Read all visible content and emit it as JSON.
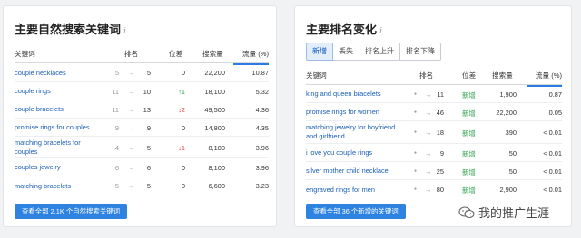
{
  "left_card": {
    "title": "主要自然搜索关键词",
    "info_glyph": "i",
    "headers": {
      "keyword": "关键词",
      "rank": "排名",
      "position": "位差",
      "volume": "搜索量",
      "traffic": "流量 (%)"
    },
    "rows": [
      {
        "keyword": "couple necklaces",
        "prev": "5",
        "arrow": "→",
        "rank": "5",
        "pos": "0",
        "dir": "none",
        "volume": "22,200",
        "traffic": "10.87"
      },
      {
        "keyword": "couple rings",
        "prev": "11",
        "arrow": "→",
        "rank": "10",
        "pos": "↑1",
        "dir": "up",
        "volume": "18,100",
        "traffic": "5.32"
      },
      {
        "keyword": "couple bracelets",
        "prev": "11",
        "arrow": "→",
        "rank": "13",
        "pos": "↓2",
        "dir": "down",
        "volume": "49,500",
        "traffic": "4.36"
      },
      {
        "keyword": "promise rings for couples",
        "prev": "9",
        "arrow": "→",
        "rank": "9",
        "pos": "0",
        "dir": "none",
        "volume": "14,800",
        "traffic": "4.35"
      },
      {
        "keyword": "matching bracelets for couples",
        "prev": "4",
        "arrow": "→",
        "rank": "5",
        "pos": "↓1",
        "dir": "down",
        "volume": "8,100",
        "traffic": "3.96"
      },
      {
        "keyword": "couples jewelry",
        "prev": "6",
        "arrow": "→",
        "rank": "6",
        "pos": "0",
        "dir": "none",
        "volume": "8,100",
        "traffic": "3.96"
      },
      {
        "keyword": "matching bracelets",
        "prev": "5",
        "arrow": "→",
        "rank": "5",
        "pos": "0",
        "dir": "none",
        "volume": "6,600",
        "traffic": "3.23"
      }
    ],
    "button": "查看全部 2.1K 个自然搜索关键词"
  },
  "right_card": {
    "title": "主要排名变化",
    "info_glyph": "i",
    "tabs": [
      "新增",
      "丢失",
      "排名上升",
      "排名下降"
    ],
    "active_tab": 0,
    "headers": {
      "keyword": "关键词",
      "rank": "排名",
      "position": "位差",
      "volume": "搜索量",
      "traffic": "流量 (%)"
    },
    "rows": [
      {
        "keyword": "king and queen bracelets",
        "prev": "●",
        "arrow": "→",
        "rank": "11",
        "pos": "新增",
        "volume": "1,900",
        "traffic": "0.87"
      },
      {
        "keyword": "promise rings for women",
        "prev": "●",
        "arrow": "→",
        "rank": "46",
        "pos": "新增",
        "volume": "22,200",
        "traffic": "0.05"
      },
      {
        "keyword": "matching jewelry for boyfriend and girlfriend",
        "prev": "●",
        "arrow": "→",
        "rank": "18",
        "pos": "新增",
        "volume": "390",
        "traffic": "< 0.01"
      },
      {
        "keyword": "i love you couple rings",
        "prev": "●",
        "arrow": "→",
        "rank": "9",
        "pos": "新增",
        "volume": "50",
        "traffic": "< 0.01"
      },
      {
        "keyword": "silver mother child necklace",
        "prev": "●",
        "arrow": "→",
        "rank": "25",
        "pos": "新增",
        "volume": "50",
        "traffic": "< 0.01"
      },
      {
        "keyword": "engraved rings for men",
        "prev": "●",
        "arrow": "→",
        "rank": "80",
        "pos": "新增",
        "volume": "2,900",
        "traffic": "< 0.01"
      }
    ],
    "button": "查看全部 36 个新增的关键词"
  },
  "watermark": {
    "text": "我的推广生涯",
    "icon": "wechat-icon"
  },
  "colors": {
    "link": "#1a5fb4",
    "button": "#2f83e0",
    "up": "#2aa14b",
    "down": "#e53b3b",
    "sort_underline": "#2c7be5"
  }
}
